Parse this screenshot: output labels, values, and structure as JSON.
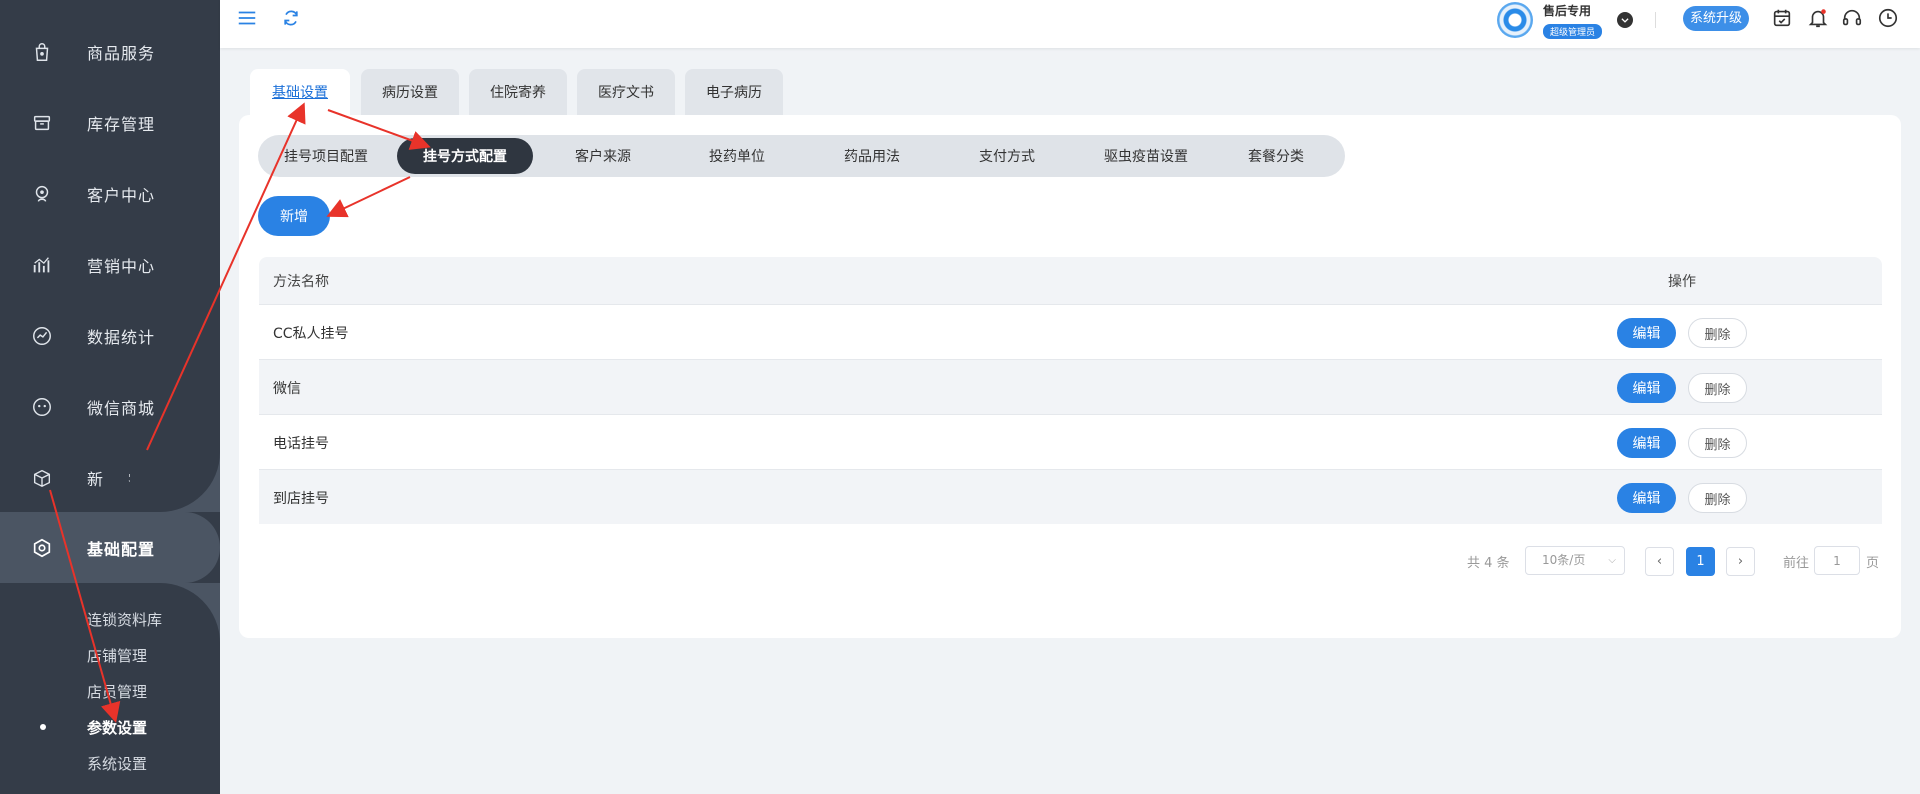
{
  "sidebar": {
    "items": [
      {
        "label": "商品服务",
        "icon": "bag-icon"
      },
      {
        "label": "库存管理",
        "icon": "inventory-icon"
      },
      {
        "label": "客户中心",
        "icon": "customer-icon"
      },
      {
        "label": "营销中心",
        "icon": "marketing-icon"
      },
      {
        "label": "数据统计",
        "icon": "stats-icon"
      },
      {
        "label": "微信商城",
        "icon": "wechat-icon"
      },
      {
        "label": "新 零 售",
        "icon": "retail-box-icon"
      },
      {
        "label": "基础配置",
        "icon": "settings-hex-icon"
      }
    ],
    "sub_items": [
      "连锁资料库",
      "店铺管理",
      "店员管理",
      "参数设置",
      "系统设置"
    ],
    "active_sub_index": 3
  },
  "header": {
    "menu_icon": "hamburger-icon",
    "refresh_icon": "refresh-icon",
    "user_name": "售后专用",
    "user_role": "超级管理员",
    "upgrade_label": "系统升级",
    "right_icons": [
      "calendar-check-icon",
      "bell-icon",
      "headset-icon",
      "clock-icon"
    ]
  },
  "top_tabs": [
    "基础设置",
    "病历设置",
    "住院寄养",
    "医疗文书",
    "电子病历"
  ],
  "sub_tabs": [
    "挂号项目配置",
    "挂号方式配置",
    "客户来源",
    "投药单位",
    "药品用法",
    "支付方式",
    "驱虫疫苗设置",
    "套餐分类"
  ],
  "add_label": "新增",
  "table": {
    "headers": {
      "name": "方法名称",
      "ops": "操作"
    },
    "rows": [
      "CC私人挂号",
      "微信",
      "电话挂号",
      "到店挂号"
    ],
    "edit_label": "编辑",
    "delete_label": "删除"
  },
  "pagination": {
    "total": "共 4 条",
    "page_size": "10条/页",
    "prev": "‹",
    "current": "1",
    "next": "›",
    "goto_label": "前往",
    "goto_value": "1",
    "page_unit": "页"
  },
  "colors": {
    "sidebar": "#343c48",
    "primary": "#2a82e4",
    "annotation": "#e8332a"
  }
}
